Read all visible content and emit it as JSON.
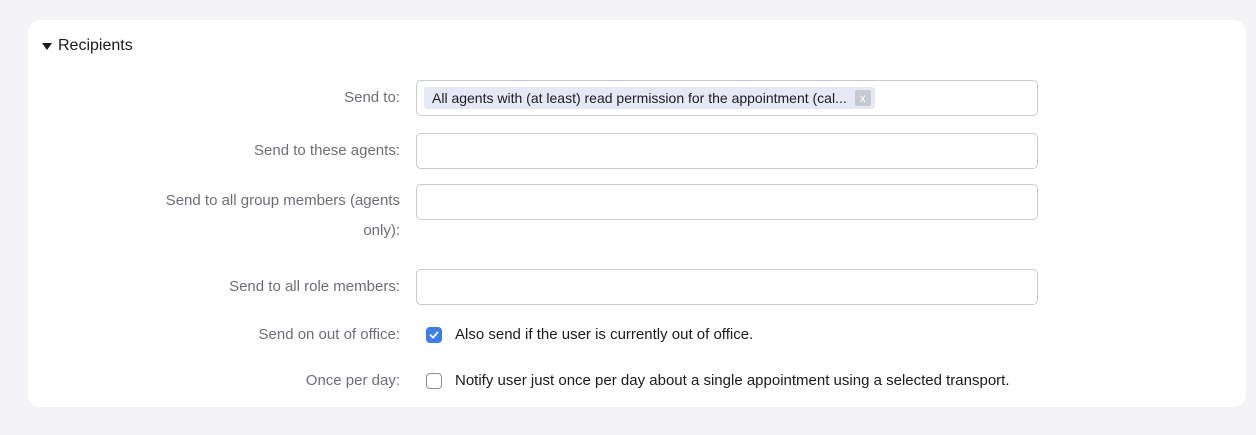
{
  "section": {
    "title": "Recipients",
    "collapse_icon": "caret-down-icon"
  },
  "fields": {
    "send_to": {
      "label": "Send to:",
      "token": "All agents with (at least) read permission for the appointment (cal...",
      "token_remove": "x"
    },
    "send_to_agents": {
      "label": "Send to these agents:",
      "value": ""
    },
    "send_to_group": {
      "label_line1": "Send to all group members (agents",
      "label_line2": "only):",
      "value": ""
    },
    "send_to_role": {
      "label": "Send to all role members:",
      "value": ""
    },
    "out_of_office": {
      "label": "Send on out of office:",
      "checkbox_text": "Also send if the user is currently out of office.",
      "checked": true
    },
    "once_per_day": {
      "label": "Once per day:",
      "checkbox_text": "Notify user just once per day about a single appointment using a selected transport.",
      "checked": false
    }
  },
  "colors": {
    "checkbox_accent": "#3d7ee6",
    "token_bg": "#e6e8f5",
    "label_text": "#6e6e78"
  }
}
